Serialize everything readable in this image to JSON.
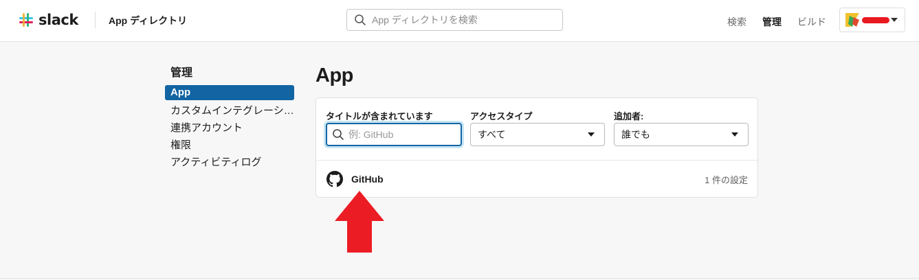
{
  "header": {
    "logo_text": "slack",
    "title": "App ディレクトリ",
    "search_placeholder": "App ディレクトリを検索",
    "nav": {
      "search": "検索",
      "manage": "管理",
      "build": "ビルド"
    },
    "team": {
      "redacted_color": "#e8191f"
    }
  },
  "sidebar": {
    "heading": "管理",
    "items": [
      {
        "label": "App",
        "active": true
      },
      {
        "label": "カスタムインテグレーショ…",
        "active": false
      },
      {
        "label": "連携アカウント",
        "active": false
      },
      {
        "label": "権限",
        "active": false
      },
      {
        "label": "アクティビティログ",
        "active": false
      }
    ]
  },
  "main": {
    "title": "App",
    "filters": {
      "title_filter": {
        "label": "タイトルが含まれています",
        "placeholder": "例: GitHub",
        "value": ""
      },
      "access_type": {
        "label": "アクセスタイプ",
        "value": "すべて"
      },
      "added_by": {
        "label": "追加者:",
        "value": "誰でも"
      }
    },
    "apps": [
      {
        "name": "GitHub",
        "icon": "github-icon",
        "meta": "1 件の設定"
      }
    ]
  },
  "annotation": {
    "arrow_color": "#ec1c24",
    "arrow_direction": "up"
  },
  "colors": {
    "accent": "#1264a3"
  }
}
